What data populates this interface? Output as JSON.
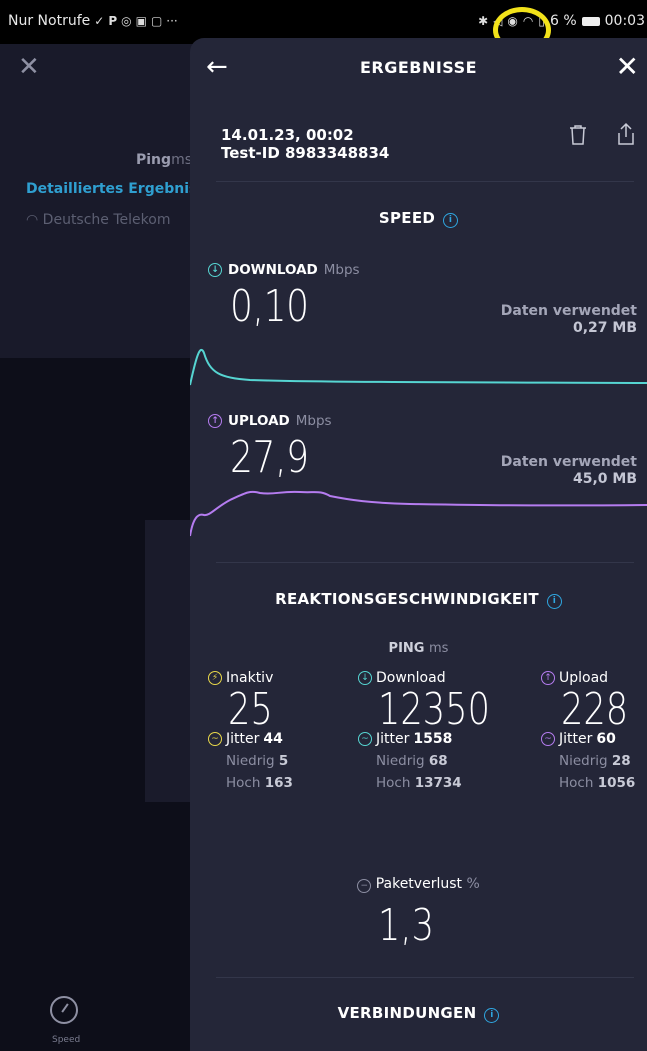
{
  "statusbar": {
    "carrier": "Nur Notrufe",
    "battery": "6 %",
    "time": "00:03"
  },
  "background": {
    "ping_label": "Ping",
    "ping_unit": "ms",
    "detail_link": "Detailliertes Ergebnis",
    "provider": "Deutsche Telekom",
    "nav_label": "Speed"
  },
  "header": {
    "title": "ERGEBNISSE"
  },
  "result": {
    "date": "14.01.23, 00:02",
    "test_id": "Test-ID 8983348834"
  },
  "speed": {
    "title": "SPEED",
    "download": {
      "label": "DOWNLOAD",
      "unit": "Mbps",
      "value": "0,10",
      "data_used_label": "Daten verwendet",
      "data_used_value": "0,27 MB",
      "color": "#56d5d2"
    },
    "upload": {
      "label": "UPLOAD",
      "unit": "Mbps",
      "value": "27,9",
      "data_used_label": "Daten verwendet",
      "data_used_value": "45,0 MB",
      "color": "#b57cf0"
    }
  },
  "reaction": {
    "title": "REAKTIONSGESCHWINDIGKEIT",
    "ping_label": "PING",
    "ping_unit": "ms",
    "columns": [
      {
        "label": "Inaktiv",
        "value": "25",
        "jitter_label": "Jitter",
        "jitter": "44",
        "low_label": "Niedrig",
        "low": "5",
        "high_label": "Hoch",
        "high": "163",
        "color": "#e8d84a"
      },
      {
        "label": "Download",
        "value": "12350",
        "jitter_label": "Jitter",
        "jitter": "1558",
        "low_label": "Niedrig",
        "low": "68",
        "high_label": "Hoch",
        "high": "13734",
        "color": "#56d5d2"
      },
      {
        "label": "Upload",
        "value": "228",
        "jitter_label": "Jitter",
        "jitter": "60",
        "low_label": "Niedrig",
        "low": "28",
        "high_label": "Hoch",
        "high": "1056",
        "color": "#b57cf0"
      }
    ],
    "packet_loss_label": "Paketverlust",
    "packet_loss_unit": "%",
    "packet_loss_value": "1,3"
  },
  "connections": {
    "title": "VERBINDUNGEN"
  }
}
